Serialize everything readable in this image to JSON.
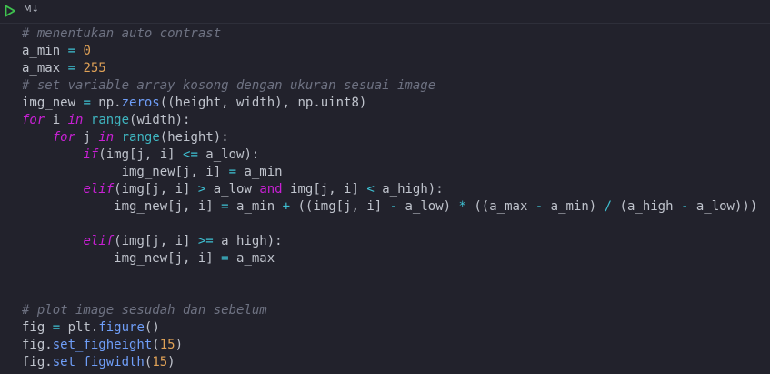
{
  "toolbar": {
    "run_icon": "play-icon",
    "cell_type_label": "M↓"
  },
  "colors": {
    "background": "#22222c",
    "comment": "#6e7282",
    "operator": "#3ec1d3",
    "number": "#e0a257",
    "function": "#6f9ef8",
    "keyword": "#c820d4",
    "builtin": "#3fb5c0",
    "text": "#bfc3cc"
  },
  "code_lines": [
    [
      [
        "comment",
        "# menentukan auto contrast"
      ]
    ],
    [
      [
        "",
        "a_min "
      ],
      [
        "op",
        "="
      ],
      [
        "",
        " "
      ],
      [
        "num",
        "0"
      ]
    ],
    [
      [
        "",
        "a_max "
      ],
      [
        "op",
        "="
      ],
      [
        "",
        " "
      ],
      [
        "num",
        "255"
      ]
    ],
    [
      [
        "comment",
        "# set variable array kosong dengan ukuran sesuai image"
      ]
    ],
    [
      [
        "",
        "img_new "
      ],
      [
        "op",
        "="
      ],
      [
        "",
        " np."
      ],
      [
        "fn",
        "zeros"
      ],
      [
        "",
        "((height, width), np.uint8)"
      ]
    ],
    [
      [
        "kw",
        "for"
      ],
      [
        "",
        " i "
      ],
      [
        "kw",
        "in"
      ],
      [
        "",
        " "
      ],
      [
        "builtin",
        "range"
      ],
      [
        "",
        "(width):"
      ]
    ],
    [
      [
        "",
        "    "
      ],
      [
        "kw",
        "for"
      ],
      [
        "",
        " j "
      ],
      [
        "kw",
        "in"
      ],
      [
        "",
        " "
      ],
      [
        "builtin",
        "range"
      ],
      [
        "",
        "(height):"
      ]
    ],
    [
      [
        "",
        "        "
      ],
      [
        "kw",
        "if"
      ],
      [
        "",
        "(img[j, i] "
      ],
      [
        "op",
        "<="
      ],
      [
        "",
        " a_low):"
      ]
    ],
    [
      [
        "",
        "             img_new[j, i] "
      ],
      [
        "op",
        "="
      ],
      [
        "",
        " a_min"
      ]
    ],
    [
      [
        "",
        "        "
      ],
      [
        "kw",
        "elif"
      ],
      [
        "",
        "(img[j, i] "
      ],
      [
        "op",
        ">"
      ],
      [
        "",
        " a_low "
      ],
      [
        "kw2",
        "and"
      ],
      [
        "",
        " img[j, i] "
      ],
      [
        "op",
        "<"
      ],
      [
        "",
        " a_high):"
      ]
    ],
    [
      [
        "",
        "            img_new[j, i] "
      ],
      [
        "op",
        "="
      ],
      [
        "",
        " a_min "
      ],
      [
        "op",
        "+"
      ],
      [
        "",
        " ((img[j, i] "
      ],
      [
        "op",
        "-"
      ],
      [
        "",
        " a_low) "
      ],
      [
        "op",
        "*"
      ],
      [
        "",
        " ((a_max "
      ],
      [
        "op",
        "-"
      ],
      [
        "",
        " a_min) "
      ],
      [
        "op",
        "/"
      ],
      [
        "",
        " (a_high "
      ],
      [
        "op",
        "-"
      ],
      [
        "",
        " a_low)))"
      ]
    ],
    [],
    [
      [
        "",
        "        "
      ],
      [
        "kw",
        "elif"
      ],
      [
        "",
        "(img[j, i] "
      ],
      [
        "op",
        ">="
      ],
      [
        "",
        " a_high):"
      ]
    ],
    [
      [
        "",
        "            img_new[j, i] "
      ],
      [
        "op",
        "="
      ],
      [
        "",
        " a_max"
      ]
    ],
    [],
    [],
    [
      [
        "comment",
        "# plot image sesudah dan sebelum"
      ]
    ],
    [
      [
        "",
        "fig "
      ],
      [
        "op",
        "="
      ],
      [
        "",
        " plt."
      ],
      [
        "fn",
        "figure"
      ],
      [
        "",
        "()"
      ]
    ],
    [
      [
        "",
        "fig."
      ],
      [
        "fn",
        "set_figheight"
      ],
      [
        "",
        "("
      ],
      [
        "num",
        "15"
      ],
      [
        "",
        ")"
      ]
    ],
    [
      [
        "",
        "fig."
      ],
      [
        "fn",
        "set_figwidth"
      ],
      [
        "",
        "("
      ],
      [
        "num",
        "15"
      ],
      [
        "",
        ")"
      ]
    ]
  ]
}
